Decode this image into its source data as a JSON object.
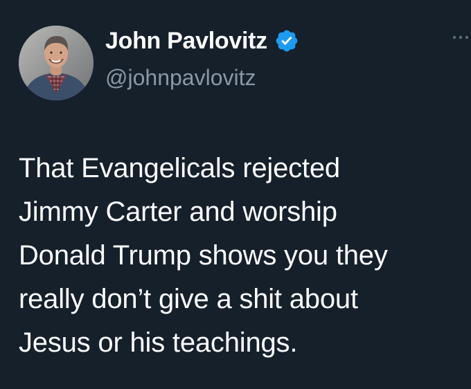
{
  "author": {
    "display_name": "John Pavlovitz",
    "handle": "@johnpavlovitz",
    "verified": true
  },
  "tweet": {
    "lines": [
      "That Evangelicals rejected",
      "Jimmy Carter and worship",
      "Donald Trump shows you they",
      "really don’t give a shit about",
      "Jesus or his teachings."
    ]
  },
  "icons": {
    "verified": "verified-badge-icon",
    "more": "more-options-icon"
  },
  "colors": {
    "background": "#15202b",
    "text": "#ffffff",
    "secondary_text": "#8b98a5",
    "verified": "#1d9bf0"
  }
}
